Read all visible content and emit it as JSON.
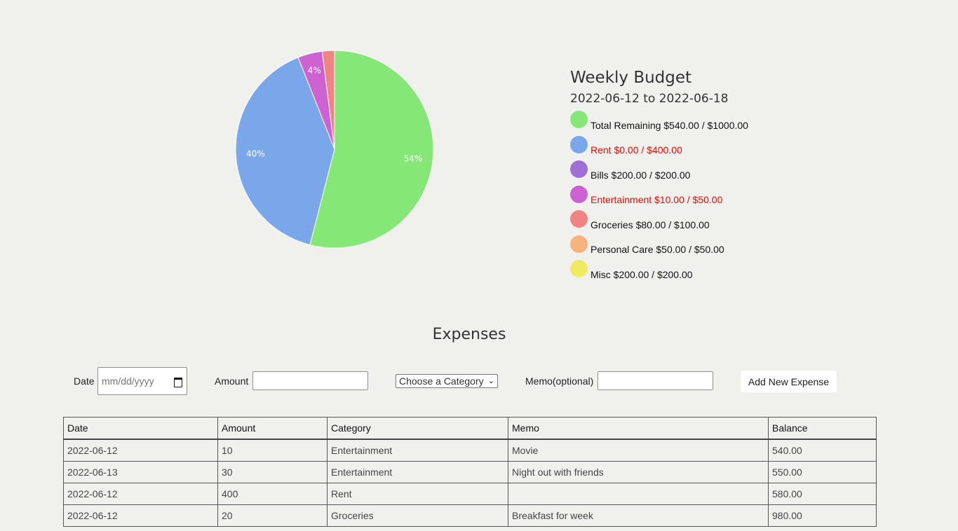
{
  "chart_data": {
    "type": "pie",
    "slices": [
      {
        "label": "Total Remaining",
        "value": 54,
        "label_text": "54%",
        "color": "#84e776"
      },
      {
        "label": "Rent",
        "value": 40,
        "label_text": "40%",
        "color": "#79a7ea"
      },
      {
        "label": "Bills",
        "value": 0,
        "label_text": "",
        "color": "#9f6ed6"
      },
      {
        "label": "Entertainment",
        "value": 4,
        "label_text": "4%",
        "color": "#cd63d2"
      },
      {
        "label": "Groceries",
        "value": 2,
        "label_text": "",
        "color": "#f08383"
      },
      {
        "label": "Personal Care",
        "value": 0,
        "label_text": "",
        "color": "#f6b37b"
      },
      {
        "label": "Misc",
        "value": 0,
        "label_text": "",
        "color": "#f0ea62"
      }
    ]
  },
  "legend": {
    "title": "Weekly Budget",
    "range": "2022-06-12 to 2022-06-18",
    "items": [
      {
        "label": "Total Remaining $540.00 / $1000.00",
        "color": "#84e776",
        "text_color": "#111111"
      },
      {
        "label": "Rent $0.00 / $400.00",
        "color": "#79a7ea",
        "text_color": "#ff0000"
      },
      {
        "label": "Bills $200.00 / $200.00",
        "color": "#9f6ed6",
        "text_color": "#111111"
      },
      {
        "label": "Entertainment $10.00 / $50.00",
        "color": "#cd63d2",
        "text_color": "#ff0000"
      },
      {
        "label": "Groceries $80.00 / $100.00",
        "color": "#f08383",
        "text_color": "#111111"
      },
      {
        "label": "Personal Care $50.00 / $50.00",
        "color": "#f6b37b",
        "text_color": "#111111"
      },
      {
        "label": "Misc $200.00 / $200.00",
        "color": "#f0ea62",
        "text_color": "#111111"
      }
    ]
  },
  "expenses": {
    "title": "Expenses",
    "form": {
      "date_label": "Date",
      "date_placeholder": "mm/dd/yyyy",
      "amount_label": "Amount",
      "category_selected": "Choose a Category",
      "memo_label": "Memo(optional)",
      "add_button": "Add New Expense"
    },
    "table": {
      "headers": [
        "Date",
        "Amount",
        "Category",
        "Memo",
        "Balance"
      ],
      "rows": [
        [
          "2022-06-12",
          "10",
          "Entertainment",
          "Movie",
          "540.00"
        ],
        [
          "2022-06-13",
          "30",
          "Entertainment",
          "Night out with friends",
          "550.00"
        ],
        [
          "2022-06-12",
          "400",
          "Rent",
          "",
          "580.00"
        ],
        [
          "2022-06-12",
          "20",
          "Groceries",
          "Breakfast for week",
          "980.00"
        ]
      ]
    }
  }
}
